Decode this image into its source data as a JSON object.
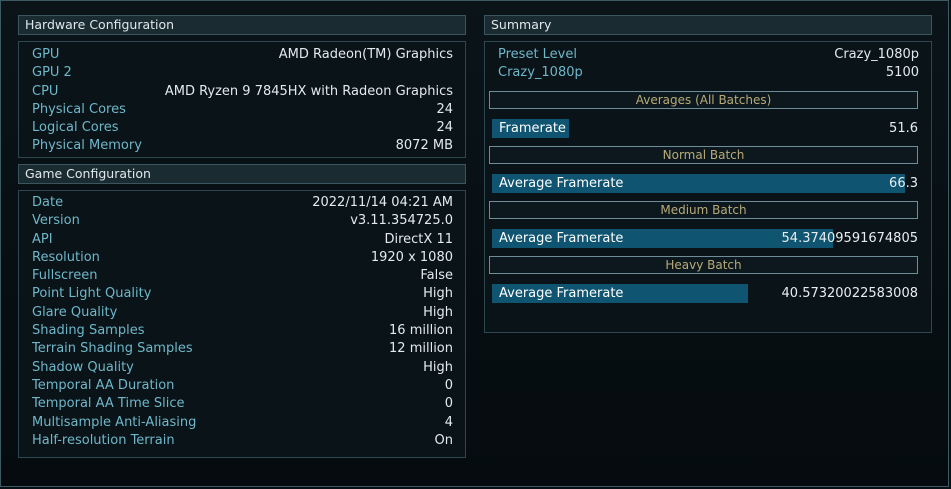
{
  "hardware": {
    "title": "Hardware Configuration",
    "rows": [
      {
        "label": "GPU",
        "value": "AMD Radeon(TM) Graphics"
      },
      {
        "label": "GPU 2",
        "value": ""
      },
      {
        "label": "CPU",
        "value": "AMD Ryzen 9 7845HX with Radeon Graphics"
      },
      {
        "label": "Physical Cores",
        "value": "24"
      },
      {
        "label": "Logical Cores",
        "value": "24"
      },
      {
        "label": "Physical Memory",
        "value": "8072 MB"
      }
    ]
  },
  "game": {
    "title": "Game Configuration",
    "rows": [
      {
        "label": "Date",
        "value": "2022/11/14 04:21 AM"
      },
      {
        "label": "Version",
        "value": "v3.11.354725.0"
      },
      {
        "label": "API",
        "value": "DirectX 11"
      },
      {
        "label": "Resolution",
        "value": "1920 x 1080"
      },
      {
        "label": "Fullscreen",
        "value": "False"
      },
      {
        "label": "Point Light Quality",
        "value": "High"
      },
      {
        "label": "Glare Quality",
        "value": "High"
      },
      {
        "label": "Shading Samples",
        "value": "16 million"
      },
      {
        "label": "Terrain Shading Samples",
        "value": "12 million"
      },
      {
        "label": "Shadow Quality",
        "value": "High"
      },
      {
        "label": "Temporal AA Duration",
        "value": "0"
      },
      {
        "label": "Temporal AA Time Slice",
        "value": "0"
      },
      {
        "label": "Multisample Anti-Aliasing",
        "value": "4"
      },
      {
        "label": "Half-resolution Terrain",
        "value": "On"
      }
    ]
  },
  "summary": {
    "title": "Summary",
    "rows": [
      {
        "label": "Preset Level",
        "value": "Crazy_1080p"
      },
      {
        "label": "Crazy_1080p",
        "value": "5100"
      }
    ],
    "batches": [
      {
        "header": "Averages (All Batches)",
        "label": "Framerate",
        "value": "51.6",
        "fill_fraction": 0.18
      },
      {
        "header": "Normal Batch",
        "label": "Average Framerate",
        "value": "66.3",
        "fill_fraction": 0.97
      },
      {
        "header": "Medium Batch",
        "label": "Average Framerate",
        "value": "54.37409591674805",
        "fill_fraction": 0.8
      },
      {
        "header": "Heavy Batch",
        "label": "Average Framerate",
        "value": "40.5732002258300​8",
        "fill_fraction": 0.6
      }
    ]
  }
}
